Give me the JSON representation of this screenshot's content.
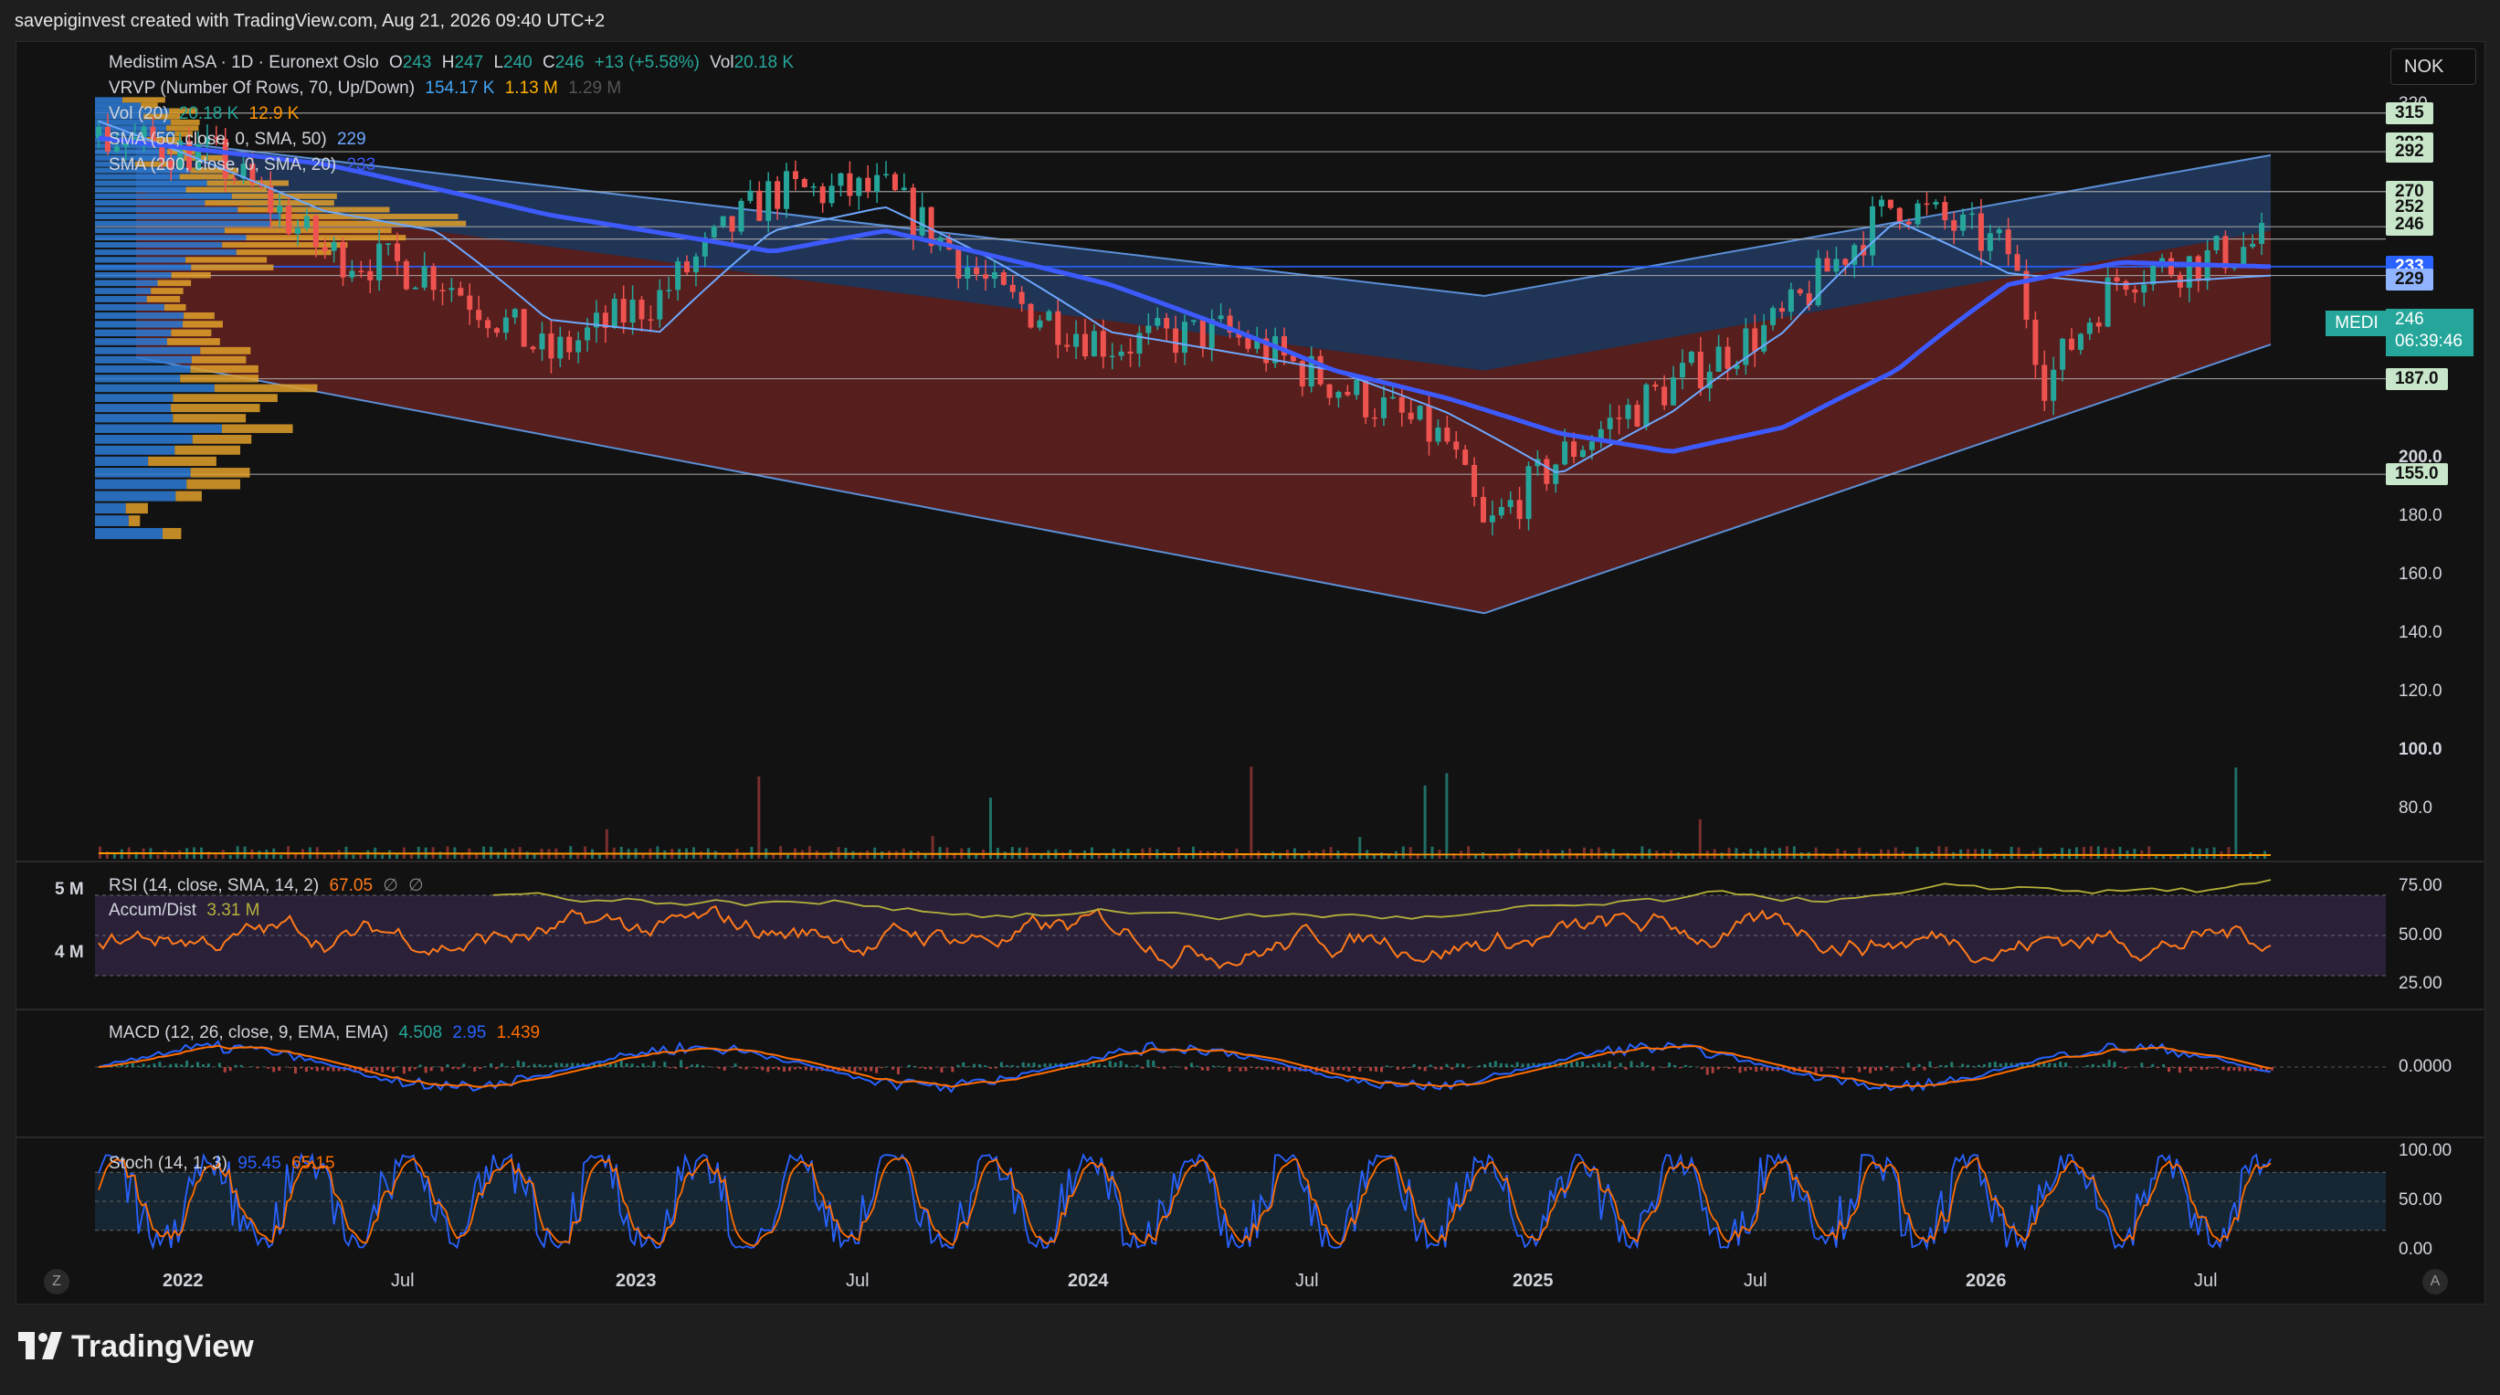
{
  "header": {
    "attribution": "savepiginvest created with TradingView.com, Aug 21, 2026 09:40 UTC+2"
  },
  "currency": "NOK",
  "symbol_tag": "MEDI",
  "last_price": {
    "value": "246",
    "countdown": "06:39:46"
  },
  "legend": {
    "main": {
      "name": "Medistim ASA · 1D · Euronext Oslo",
      "o_label": "O",
      "o": "243",
      "h_label": "H",
      "h": "247",
      "l_label": "L",
      "l": "240",
      "c_label": "C",
      "c": "246",
      "change": "+13 (+5.58%)",
      "vol_label": "Vol",
      "vol": "20.18 K"
    },
    "vrvp": {
      "name": "VRVP (Number Of Rows, 70, Up/Down)",
      "v1": "154.17 K",
      "v2": "1.13 M",
      "v3": "1.29 M"
    },
    "vol": {
      "name": "Vol (20)",
      "v1": "20.18 K",
      "v2": "12.9 K"
    },
    "sma50": {
      "name": "SMA (50, close, 0, SMA, 50)",
      "value": "229"
    },
    "sma200": {
      "name": "SMA (200, close, 0, SMA, 20)",
      "value": "233"
    },
    "rsi": {
      "name": "RSI (14, close, SMA, 14, 2)",
      "value": "67.05",
      "e1": "∅",
      "e2": "∅"
    },
    "accum": {
      "name": "Accum/Dist",
      "value": "3.31 M"
    },
    "macd": {
      "name": "MACD (12, 26, close, 9, EMA, EMA)",
      "v1": "4.508",
      "v2": "2.95",
      "v3": "1.439"
    },
    "stoch": {
      "name": "Stoch (14, 1, 3)",
      "v1": "95.45",
      "v2": "65.15"
    }
  },
  "price_tags": [
    {
      "label": "315",
      "value": 315,
      "color": "#c8e6c9"
    },
    {
      "label": "292",
      "value": 297,
      "color": "#c8e6c9"
    },
    {
      "label": "292",
      "value": 292,
      "color": "#c8e6c9"
    },
    {
      "label": "270",
      "value": 270,
      "color": "#c8e6c9"
    },
    {
      "label": "252",
      "value": 262,
      "color": "#c8e6c9"
    },
    {
      "label": "246",
      "value": 253,
      "color": "#c8e6c9"
    },
    {
      "label": "233",
      "value": 233,
      "color": "#2962ff"
    },
    {
      "label": "229",
      "value": 227,
      "color": "#90b4ff"
    },
    {
      "label": "187.0",
      "value": 187,
      "color": "#c8e6c9"
    },
    {
      "label": "155.0",
      "value": 155,
      "color": "#c8e6c9"
    }
  ],
  "y_axis": {
    "price_labels": [
      "320",
      "280",
      "200.0",
      "180.0",
      "160.0",
      "140.0",
      "120.0",
      "100.0",
      "80.0"
    ],
    "bold_labels": [
      "200.0",
      "100.0"
    ],
    "volume_labels": [
      "5 M",
      "4 M"
    ],
    "rsi_labels": [
      "75.00",
      "50.00",
      "25.00"
    ],
    "macd_labels": [
      "0.0000"
    ],
    "stoch_labels": [
      "100.00",
      "50.00",
      "0.00"
    ]
  },
  "x_axis": {
    "labels": [
      "2022",
      "Jul",
      "2023",
      "Jul",
      "2024",
      "Jul",
      "2025",
      "Jul",
      "2026",
      "Jul"
    ],
    "bold": [
      "2022",
      "2023",
      "2024",
      "2025",
      "2026"
    ]
  },
  "buttons": {
    "left": "Z",
    "right": "A"
  },
  "footer": {
    "brand": "TradingView"
  },
  "colors": {
    "up": "#26a69a",
    "down": "#ef5350",
    "sma50": "#6ea8fe",
    "sma200": "#3d5afe",
    "rsi": "#ff7a1a",
    "accum": "#b5b03a",
    "macd": "#2962ff",
    "signal": "#ff6d00"
  },
  "chart_data": {
    "type": "line",
    "title": "Medistim ASA · 1D · Euronext Oslo",
    "x_range": [
      "2021-10",
      "2026-08"
    ],
    "y_scale": "log",
    "ylim": [
      70,
      330
    ],
    "series": [
      {
        "name": "Medistim ASA",
        "x": [
          "2021-10",
          "2022-01",
          "2022-04",
          "2022-07",
          "2022-10",
          "2023-01",
          "2023-04",
          "2023-07",
          "2023-10",
          "2024-01",
          "2024-04",
          "2024-07",
          "2024-10",
          "2024-11",
          "2025-01",
          "2025-04",
          "2025-07",
          "2025-10",
          "2026-01",
          "2026-02",
          "2026-04",
          "2026-06",
          "2026-08"
        ],
        "y": [
          300,
          290,
          240,
          230,
          195,
          220,
          270,
          270,
          220,
          200,
          205,
          185,
          165,
          138,
          160,
          185,
          210,
          265,
          240,
          185,
          230,
          235,
          246
        ]
      },
      {
        "name": "SMA (50, close, 0, SMA, 50)",
        "x": [
          "2021-10",
          "2022-04",
          "2022-07",
          "2022-10",
          "2023-01",
          "2023-04",
          "2023-07",
          "2023-10",
          "2024-01",
          "2024-07",
          "2024-10",
          "2025-01",
          "2025-04",
          "2025-07",
          "2025-10",
          "2026-01",
          "2026-04",
          "2026-08"
        ],
        "y": [
          310,
          260,
          250,
          210,
          205,
          250,
          262,
          235,
          205,
          190,
          175,
          155,
          175,
          205,
          255,
          230,
          225,
          229
        ]
      },
      {
        "name": "SMA (200, close, 0, SMA, 20)",
        "x": [
          "2021-10",
          "2022-04",
          "2022-10",
          "2023-04",
          "2023-07",
          "2024-01",
          "2024-07",
          "2024-10",
          "2025-01",
          "2025-04",
          "2025-07",
          "2025-10",
          "2026-01",
          "2026-04",
          "2026-08"
        ],
        "y": [
          300,
          285,
          258,
          240,
          250,
          225,
          190,
          180,
          168,
          162,
          170,
          190,
          225,
          235,
          233
        ]
      }
    ],
    "horizontal_levels": [
      315,
      292,
      270,
      252,
      246,
      233,
      229,
      187,
      155
    ],
    "panes": [
      "RSI (14, close, SMA, 14, 2)",
      "MACD (12, 26, close, 9, EMA, EMA)",
      "Stoch (14, 1, 3)"
    ],
    "rsi_ylim": [
      20,
      80
    ],
    "stoch_ylim": [
      0,
      100
    ]
  }
}
